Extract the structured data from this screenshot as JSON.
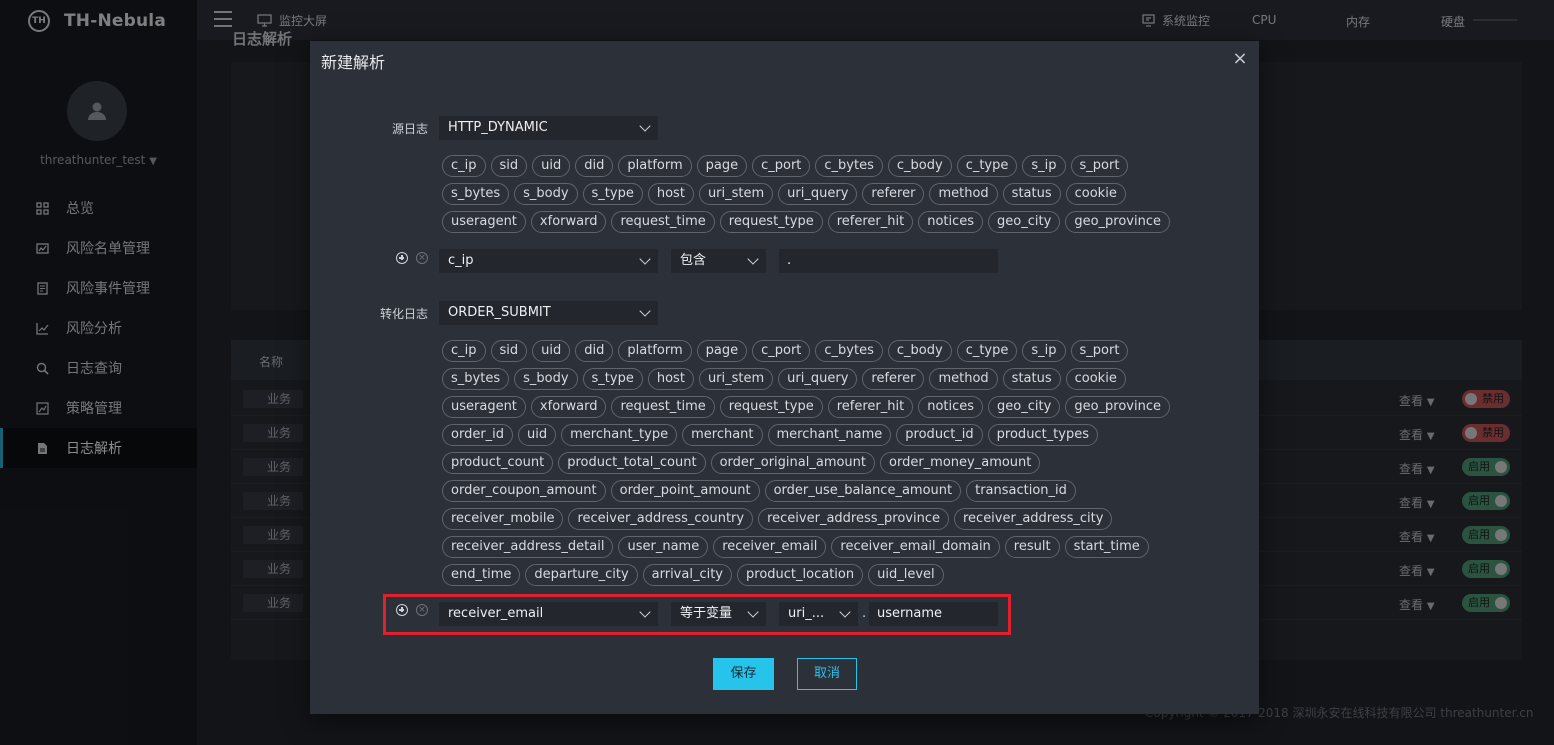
{
  "app": {
    "logo_mark": "TH",
    "name": "TH-Nebula",
    "username": "threathunter_test"
  },
  "nav": [
    {
      "label": "总览",
      "icon": "grid-icon"
    },
    {
      "label": "风险名单管理",
      "icon": "list-chart-icon"
    },
    {
      "label": "风险事件管理",
      "icon": "document-list-icon"
    },
    {
      "label": "风险分析",
      "icon": "line-chart-icon"
    },
    {
      "label": "日志查询",
      "icon": "search-icon"
    },
    {
      "label": "策略管理",
      "icon": "strategy-icon"
    },
    {
      "label": "日志解析",
      "icon": "file-icon",
      "active": true
    }
  ],
  "topbar": {
    "monitor_label": "监控大屏",
    "system_monitor": "系统监控",
    "cpu": "CPU",
    "memory": "内存",
    "disk": "硬盘"
  },
  "background": {
    "page_title": "日志解析",
    "table_header": "名称",
    "rows": [
      {
        "tag": "业务",
        "view": "查看",
        "status": "禁用",
        "on": false
      },
      {
        "tag": "业务",
        "view": "查看",
        "status": "禁用",
        "on": false
      },
      {
        "tag": "业务",
        "view": "查看",
        "status": "启用",
        "on": true
      },
      {
        "tag": "业务",
        "view": "查看",
        "status": "启用",
        "on": true
      },
      {
        "tag": "业务",
        "view": "查看",
        "status": "启用",
        "on": true
      },
      {
        "tag": "业务",
        "view": "查看",
        "status": "启用",
        "on": true
      },
      {
        "tag": "业务",
        "view": "查看",
        "status": "启用",
        "on": true
      }
    ],
    "footer": "Copyright © 2017-2018 深圳永安在线科技有限公司 threathunter.cn"
  },
  "modal": {
    "title": "新建解析",
    "close": "×",
    "source": {
      "label": "源日志",
      "value": "HTTP_DYNAMIC",
      "fields": [
        "c_ip",
        "sid",
        "uid",
        "did",
        "platform",
        "page",
        "c_port",
        "c_bytes",
        "c_body",
        "c_type",
        "s_ip",
        "s_port",
        "s_bytes",
        "s_body",
        "s_type",
        "host",
        "uri_stem",
        "uri_query",
        "referer",
        "method",
        "status",
        "cookie",
        "useragent",
        "xforward",
        "request_time",
        "request_type",
        "referer_hit",
        "notices",
        "geo_city",
        "geo_province"
      ],
      "rule": {
        "field": "c_ip",
        "op": "包含",
        "value": "."
      }
    },
    "target": {
      "label": "转化日志",
      "value": "ORDER_SUBMIT",
      "fields": [
        "c_ip",
        "sid",
        "uid",
        "did",
        "platform",
        "page",
        "c_port",
        "c_bytes",
        "c_body",
        "c_type",
        "s_ip",
        "s_port",
        "s_bytes",
        "s_body",
        "s_type",
        "host",
        "uri_stem",
        "uri_query",
        "referer",
        "method",
        "status",
        "cookie",
        "useragent",
        "xforward",
        "request_time",
        "request_type",
        "referer_hit",
        "notices",
        "geo_city",
        "geo_province",
        "order_id",
        "uid",
        "merchant_type",
        "merchant",
        "merchant_name",
        "product_id",
        "product_types",
        "product_count",
        "product_total_count",
        "order_original_amount",
        "order_money_amount",
        "order_coupon_amount",
        "order_point_amount",
        "order_use_balance_amount",
        "transaction_id",
        "receiver_mobile",
        "receiver_address_country",
        "receiver_address_province",
        "receiver_address_city",
        "receiver_address_detail",
        "user_name",
        "receiver_email",
        "receiver_email_domain",
        "result",
        "start_time",
        "end_time",
        "departure_city",
        "arrival_city",
        "product_location",
        "uid_level"
      ],
      "rule": {
        "field": "receiver_email",
        "op": "等于变量",
        "var_source": "uri_...",
        "sep": ".",
        "var_name": "username"
      }
    },
    "save": "保存",
    "cancel": "取消"
  }
}
